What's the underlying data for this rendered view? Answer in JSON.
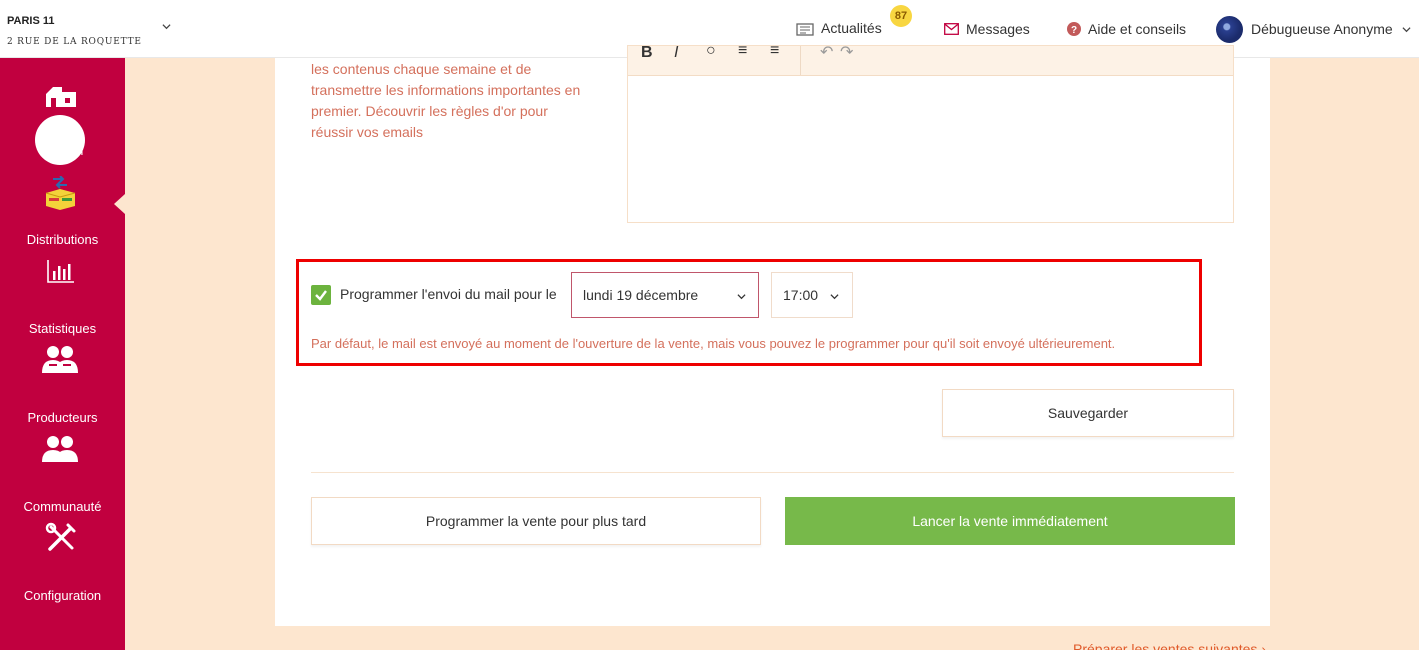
{
  "header": {
    "location_name": "PARIS 11",
    "location_address": "2 RUE DE LA ROQUETTE",
    "news_label": "Actualités",
    "news_badge": "87",
    "messages_label": "Messages",
    "help_label": "Aide et conseils",
    "user_name": "Débugueuse Anonyme"
  },
  "sidebar": {
    "items": [
      {
        "label": "Accueil",
        "icon": "home-icon"
      },
      {
        "label": "Distributions",
        "icon": "distributions-icon",
        "active": true
      },
      {
        "label": "Statistiques",
        "icon": "chart-icon"
      },
      {
        "label": "Producteurs",
        "icon": "producers-icon"
      },
      {
        "label": "Communauté",
        "icon": "community-icon"
      },
      {
        "label": "Configuration",
        "icon": "tools-icon"
      }
    ]
  },
  "main": {
    "help_text": "les contenus chaque semaine et de transmettre les informations importantes en premier. Découvrir les règles d'or pour réussir vos emails",
    "schedule": {
      "checked": true,
      "label": "Programmer l'envoi du mail pour le",
      "date_value": "lundi 19 décembre",
      "time_value": "17:00",
      "note": "Par défaut, le mail est envoyé au moment de l'ouverture de la vente, mais vous pouvez le programmer pour qu'il soit envoyé ultérieurement."
    },
    "save_label": "Sauvegarder",
    "schedule_sale_label": "Programmer la vente pour plus tard",
    "launch_sale_label": "Lancer la vente immédiatement",
    "next_link": "Préparer les ventes suivantes ›"
  },
  "colors": {
    "sidebar": "#c1003f",
    "background": "#fde6cf",
    "accent_green": "#77b94a",
    "highlight_red": "#ee0000",
    "help_text": "#d4705c"
  }
}
